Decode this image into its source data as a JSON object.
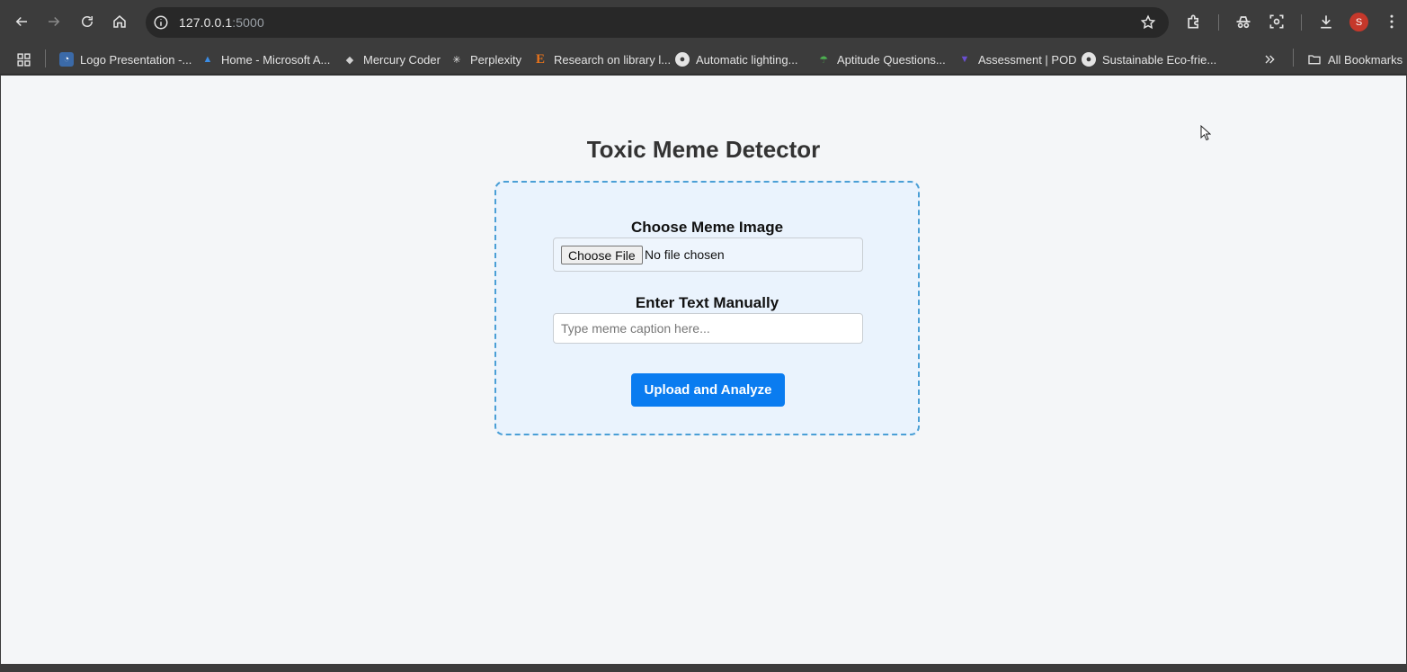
{
  "browser": {
    "url_host": "127.0.0.1",
    "url_port": ":5000",
    "avatar_initial": "S",
    "bookmarks": [
      {
        "label": "Logo Presentation -...",
        "icon": "dashboard-icon"
      },
      {
        "label": "Home - Microsoft A...",
        "icon": "azure-icon"
      },
      {
        "label": "Mercury Coder",
        "icon": "mercury-icon"
      },
      {
        "label": "Perplexity",
        "icon": "perplexity-icon"
      },
      {
        "label": "Research on library l...",
        "icon": "e-icon"
      },
      {
        "label": "Automatic lighting...",
        "icon": "globe-icon"
      },
      {
        "label": "Aptitude Questions...",
        "icon": "umbrella-icon"
      },
      {
        "label": "Assessment | POD",
        "icon": "pod-icon"
      },
      {
        "label": "Sustainable Eco-frie...",
        "icon": "globe-icon"
      }
    ],
    "all_bookmarks_label": "All Bookmarks"
  },
  "page": {
    "title": "Toxic Meme Detector",
    "file_label": "Choose Meme Image",
    "file_button": "Choose File",
    "file_status": "No file chosen",
    "text_label": "Enter Text Manually",
    "text_placeholder": "Type meme caption here...",
    "submit_label": "Upload and Analyze"
  },
  "colors": {
    "primary_button": "#0a7cf0",
    "card_border": "#4a9fd6",
    "card_background": "#eaf3fd"
  }
}
